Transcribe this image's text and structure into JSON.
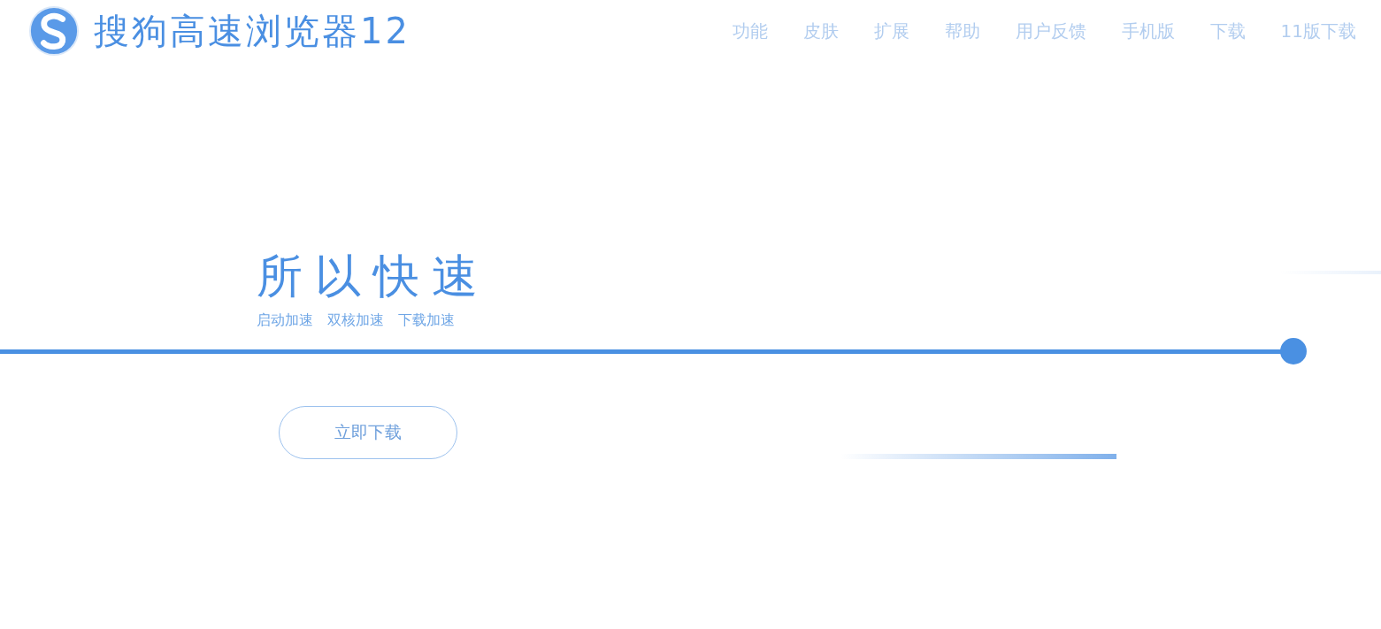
{
  "header": {
    "logo_text": "搜狗高速浏览器12",
    "nav": [
      {
        "label": "功能"
      },
      {
        "label": "皮肤"
      },
      {
        "label": "扩展"
      },
      {
        "label": "帮助"
      },
      {
        "label": "用户反馈"
      },
      {
        "label": "手机版"
      },
      {
        "label": "下载"
      },
      {
        "label": "11版下载"
      }
    ]
  },
  "hero": {
    "headline": "所以快速",
    "features": [
      "启动加速",
      "双核加速",
      "下载加速"
    ],
    "button": "立即下载"
  }
}
